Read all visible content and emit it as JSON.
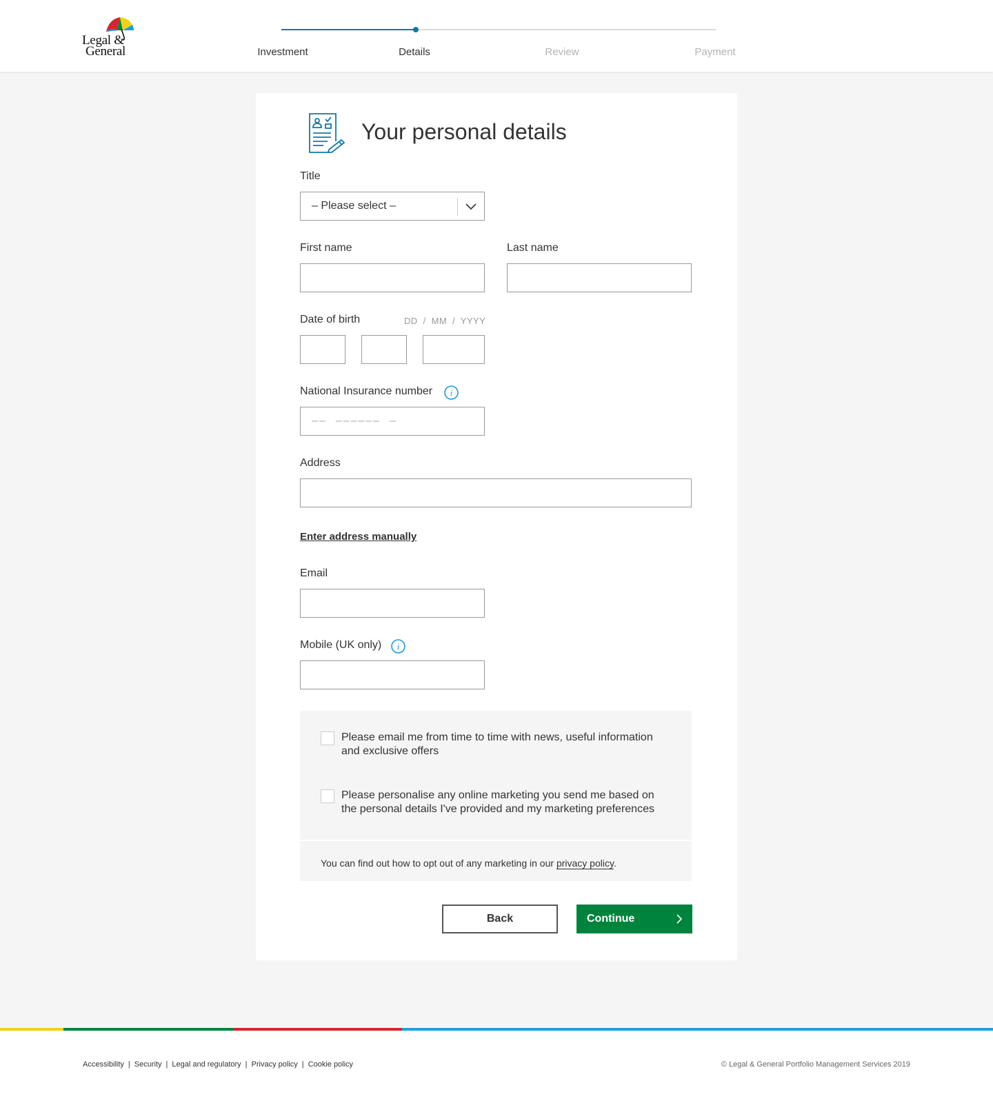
{
  "brand": {
    "line1": "Legal &",
    "line2": "General"
  },
  "steps": [
    {
      "label": "Investment",
      "state": "complete"
    },
    {
      "label": "Details",
      "state": "current"
    },
    {
      "label": "Review",
      "state": "pending"
    },
    {
      "label": "Payment",
      "state": "pending"
    }
  ],
  "progress_fraction": 0.31,
  "page_title": "Your personal details",
  "form": {
    "title_label": "Title",
    "title_value": "– Please select –",
    "first_name_label": "First name",
    "last_name_label": "Last name",
    "dob_label": "Date of birth",
    "dob_hint": "DD  /  MM  /  YYYY",
    "ni_label": "National Insurance number",
    "ni_placeholder": "––  ––––––  –",
    "address_label": "Address",
    "manual_link": "Enter address manually",
    "email_label": "Email",
    "mobile_label": "Mobile (UK only)"
  },
  "consent": {
    "email_opt": "Please email me from time to time with news, useful information and exclusive offers",
    "personalise_opt": "Please personalise any online marketing you send me based on the personal details I've provided and my marketing preferences",
    "optout_prefix": "You can find out how to opt out of any marketing in our ",
    "privacy_link": "privacy policy",
    "optout_suffix": "."
  },
  "buttons": {
    "back": "Back",
    "continue": "Continue"
  },
  "footer": {
    "links": [
      "Accessibility",
      "Security",
      "Legal and regulatory",
      "Privacy policy",
      "Cookie policy"
    ],
    "copyright": "© Legal & General Portfolio Management Services 2019"
  },
  "colors": {
    "accent_blue": "#1277a8",
    "info_blue": "#1a9ad6",
    "continue_green": "#00843d",
    "bar_yellow": "#f2d11c",
    "bar_green": "#00843d",
    "bar_red": "#d22630",
    "bar_blue": "#1ea0dc"
  }
}
